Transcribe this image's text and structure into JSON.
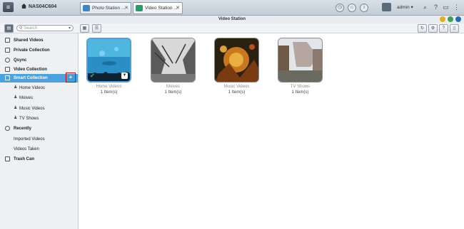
{
  "topbar": {
    "nas_name": "NAS04C604",
    "tabs": [
      {
        "label": "Photo Station ..."
      },
      {
        "label": "Video Station ..."
      }
    ],
    "user": "admin",
    "user_caret": "▾",
    "close_glyph": "✕"
  },
  "window": {
    "title": "Video Station"
  },
  "toolbar": {
    "search_placeholder": "Search"
  },
  "sidebar": {
    "shared": "Shared Videos",
    "private": "Private Collection",
    "qsync": "Qsync",
    "video_collection": "Video Collection",
    "smart_collection": "Smart Collection",
    "sub_items": [
      "Home Videos",
      "Moives",
      "Music Videos",
      "TV Shows"
    ],
    "recently": "Recently",
    "recent_items": [
      "Imported Videos",
      "Videos Taken"
    ],
    "trash": "Trash Can"
  },
  "albums": [
    {
      "name": "Home Videos",
      "count": "1 Item(s)"
    },
    {
      "name": "Moives",
      "count": "1 Item(s)"
    },
    {
      "name": "Music Videos",
      "count": "1 Item(s)"
    },
    {
      "name": "TV Shows",
      "count": "1 Item(s)"
    }
  ],
  "colors": {
    "accent": "#4aa3df",
    "highlight_box": "#d40000",
    "window_min": "#e0b020",
    "window_max": "#3fa34d",
    "window_close": "#1e6fb8"
  },
  "icons": {
    "menu": "menu-icon",
    "search": "search-icon",
    "add": "add-icon"
  }
}
